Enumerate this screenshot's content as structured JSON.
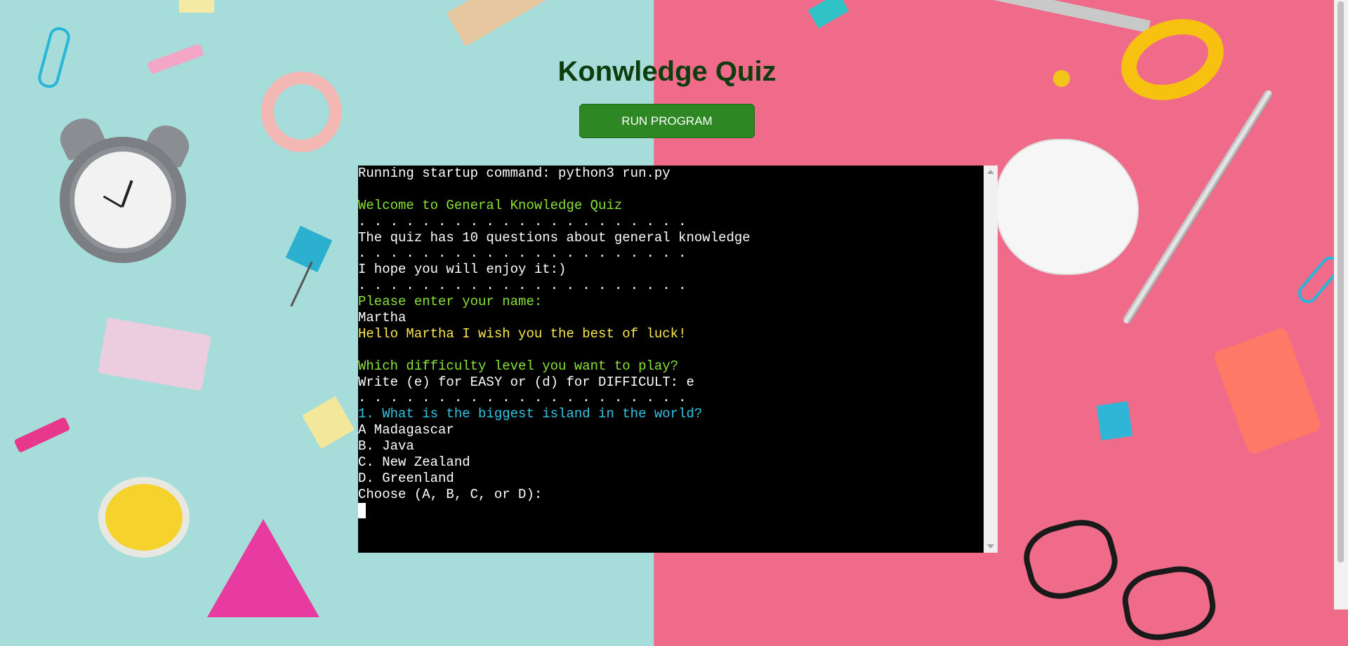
{
  "page": {
    "title": "Konwledge Quiz",
    "run_button_label": "RUN PROGRAM"
  },
  "terminal": {
    "lines": [
      {
        "text": "Running startup command: python3 run.py",
        "color": "#ffffff"
      },
      {
        "text": "",
        "color": "#ffffff"
      },
      {
        "text": "Welcome to General Knowledge Quiz",
        "color": "#8ae234"
      },
      {
        "text": ". . . . . . . . . . . . . . . . . . . . .",
        "color": "#ffffff"
      },
      {
        "text": "The quiz has 10 questions about general knowledge",
        "color": "#ffffff"
      },
      {
        "text": ". . . . . . . . . . . . . . . . . . . . .",
        "color": "#ffffff"
      },
      {
        "text": "I hope you will enjoy it:)",
        "color": "#ffffff"
      },
      {
        "text": ". . . . . . . . . . . . . . . . . . . . .",
        "color": "#ffffff"
      },
      {
        "text": "Please enter your name:",
        "color": "#8ae234"
      },
      {
        "text": "Martha",
        "color": "#ffffff"
      },
      {
        "text": "Hello Martha I wish you the best of luck!",
        "color": "#fce94f"
      },
      {
        "text": "",
        "color": "#ffffff"
      },
      {
        "text": "Which difficulty level you want to play?",
        "color": "#8ae234"
      },
      {
        "text": "Write (e) for EASY or (d) for DIFFICULT: e",
        "color": "#ffffff"
      },
      {
        "text": ". . . . . . . . . . . . . . . . . . . . .",
        "color": "#ffffff"
      },
      {
        "text": "1. What is the biggest island in the world?",
        "color": "#34c5e2"
      },
      {
        "text": "A Madagascar",
        "color": "#ffffff"
      },
      {
        "text": "B. Java",
        "color": "#ffffff"
      },
      {
        "text": "C. New Zealand",
        "color": "#ffffff"
      },
      {
        "text": "D. Greenland",
        "color": "#ffffff"
      },
      {
        "text": "Choose (A, B, C, or D):",
        "color": "#ffffff"
      }
    ],
    "background": "#000000"
  },
  "colors": {
    "title": "#0d3c0d",
    "button_bg": "#2d8722",
    "bg_left": "#a6dcd9",
    "bg_right": "#f06a8a"
  }
}
